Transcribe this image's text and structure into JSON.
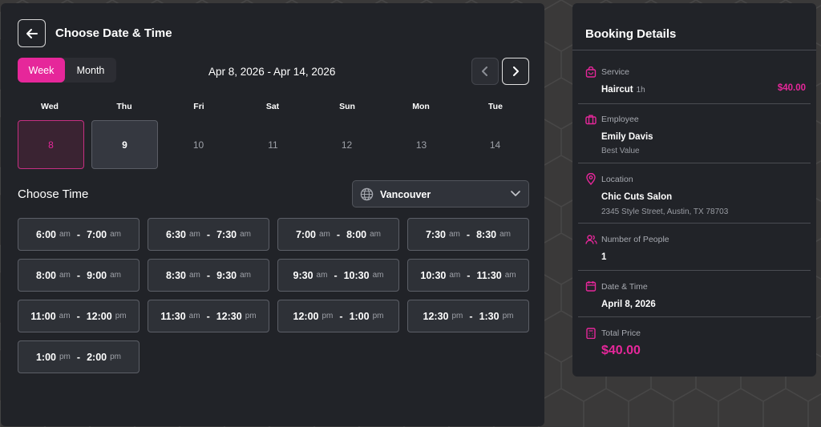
{
  "header": {
    "title": "Choose Date & Time"
  },
  "view_toggle": {
    "week_label": "Week",
    "month_label": "Month",
    "active": "Week"
  },
  "calendar": {
    "range": "Apr 8, 2026 - Apr 14, 2026",
    "days": [
      {
        "name": "Wed",
        "date": "8",
        "state": "selected"
      },
      {
        "name": "Thu",
        "date": "9",
        "state": "available"
      },
      {
        "name": "Fri",
        "date": "10",
        "state": "unavailable"
      },
      {
        "name": "Sat",
        "date": "11",
        "state": "unavailable"
      },
      {
        "name": "Sun",
        "date": "12",
        "state": "unavailable"
      },
      {
        "name": "Mon",
        "date": "13",
        "state": "unavailable"
      },
      {
        "name": "Tue",
        "date": "14",
        "state": "unavailable"
      }
    ]
  },
  "time": {
    "heading": "Choose Time",
    "timezone": "Vancouver",
    "slots": [
      {
        "start": "6:00",
        "start_ap": "am",
        "end": "7:00",
        "end_ap": "am"
      },
      {
        "start": "6:30",
        "start_ap": "am",
        "end": "7:30",
        "end_ap": "am"
      },
      {
        "start": "7:00",
        "start_ap": "am",
        "end": "8:00",
        "end_ap": "am"
      },
      {
        "start": "7:30",
        "start_ap": "am",
        "end": "8:30",
        "end_ap": "am"
      },
      {
        "start": "8:00",
        "start_ap": "am",
        "end": "9:00",
        "end_ap": "am"
      },
      {
        "start": "8:30",
        "start_ap": "am",
        "end": "9:30",
        "end_ap": "am"
      },
      {
        "start": "9:30",
        "start_ap": "am",
        "end": "10:30",
        "end_ap": "am"
      },
      {
        "start": "10:30",
        "start_ap": "am",
        "end": "11:30",
        "end_ap": "am"
      },
      {
        "start": "11:00",
        "start_ap": "am",
        "end": "12:00",
        "end_ap": "pm"
      },
      {
        "start": "11:30",
        "start_ap": "am",
        "end": "12:30",
        "end_ap": "pm"
      },
      {
        "start": "12:00",
        "start_ap": "pm",
        "end": "1:00",
        "end_ap": "pm"
      },
      {
        "start": "12:30",
        "start_ap": "pm",
        "end": "1:30",
        "end_ap": "pm"
      },
      {
        "start": "1:00",
        "start_ap": "pm",
        "end": "2:00",
        "end_ap": "pm"
      }
    ]
  },
  "booking": {
    "title": "Booking Details",
    "service": {
      "label": "Service",
      "name": "Haircut",
      "duration": "1h",
      "price": "$40.00"
    },
    "employee": {
      "label": "Employee",
      "name": "Emily Davis",
      "note": "Best Value"
    },
    "location": {
      "label": "Location",
      "name": "Chic Cuts Salon",
      "address": "2345 Style Street, Austin, TX 78703"
    },
    "people": {
      "label": "Number of People",
      "value": "1"
    },
    "datetime": {
      "label": "Date & Time",
      "value": "April 8, 2026"
    },
    "total": {
      "label": "Total Price",
      "value": "$40.00"
    }
  },
  "colors": {
    "accent": "#e6279a",
    "panel": "#212328",
    "background": "#3a3939"
  }
}
